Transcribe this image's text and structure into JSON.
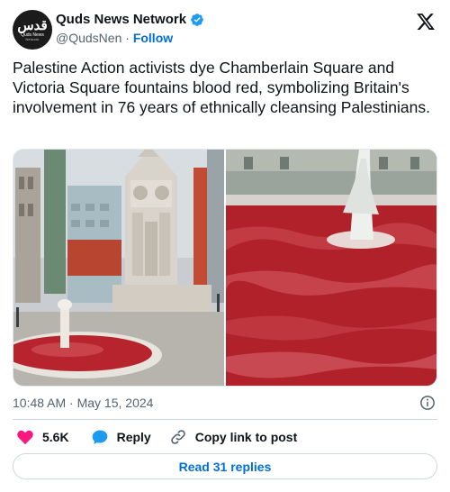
{
  "account": {
    "name": "Quds News Network",
    "handle": "@QudsNen",
    "separator": "·",
    "follow_label": "Follow",
    "avatar_text": "قدس",
    "avatar_sub": "Quds News",
    "avatar_sub2": "Network"
  },
  "tweet": {
    "text": "Palestine Action activists dye Chamberlain Square and Victoria Square fountains blood red, symbolizing Britain's involvement in 76 years of ethnically cleansing Palestinians.",
    "timestamp": "10:48 AM · May 15, 2024"
  },
  "actions": {
    "likes_count": "5.6K",
    "reply_label": "Reply",
    "copy_label": "Copy link to post"
  },
  "replies_button": "Read 31 replies",
  "icons": {
    "verified": "verified-badge-icon",
    "x_logo": "x-logo-icon",
    "info": "info-icon",
    "heart": "heart-icon",
    "reply": "reply-bubble-icon",
    "link": "link-icon"
  },
  "colors": {
    "verified": "#1d9bf0",
    "heart": "#f91880",
    "link_blue": "#006fd6",
    "secondary_text": "#536471"
  }
}
